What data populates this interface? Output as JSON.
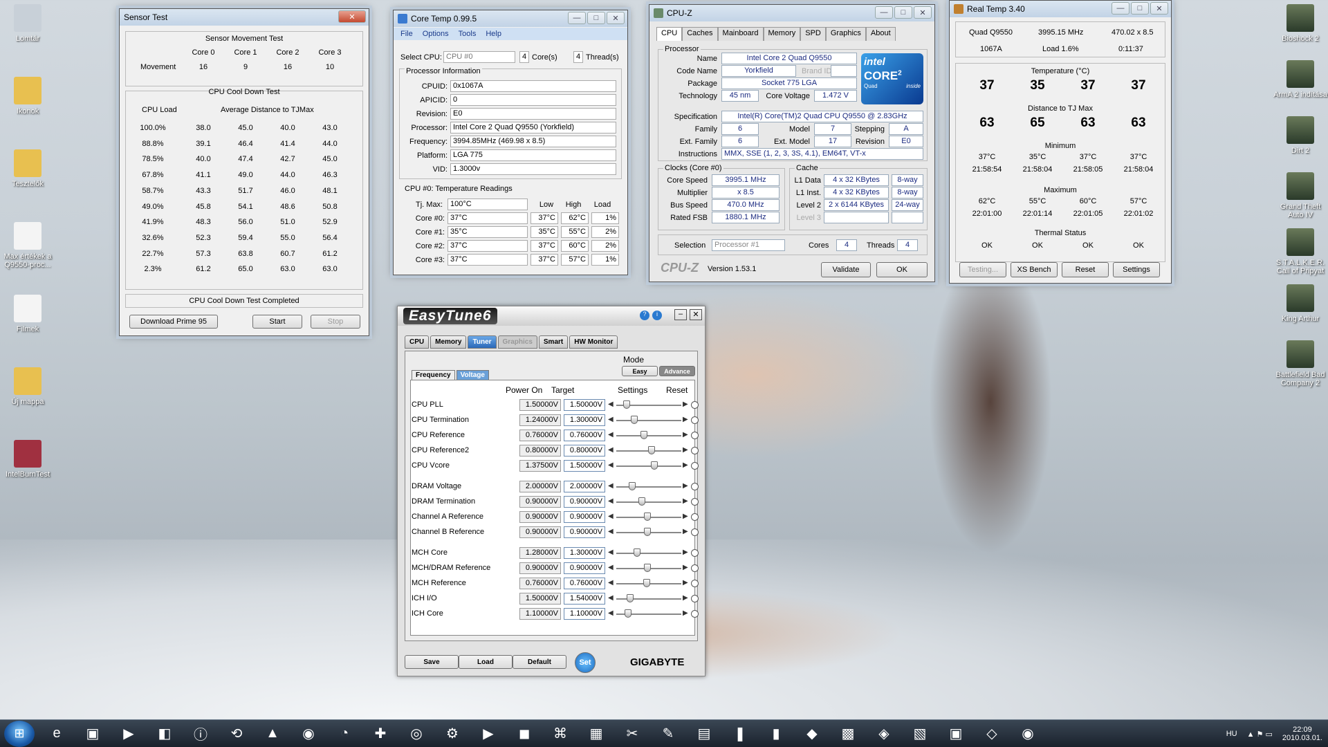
{
  "desktop": {
    "icons_left": [
      "Lomtár",
      "Ikonok",
      "Tesztelők",
      "Max értékek a Q9550-proc...",
      "Filmek",
      "Új mappa",
      "IntelBurnTest"
    ],
    "icons_right": [
      "Bioshock 2",
      "ArmA 2 indítása",
      "Dirt 2",
      "Grand Theft Auto IV",
      "S.T.A.L.K.E.R. Call of Pripyat",
      "King Arthur",
      "Battlefield Bad Company 2"
    ]
  },
  "sensor": {
    "title": "Sensor Test",
    "movement_title": "Sensor Movement Test",
    "cols": [
      "Core 0",
      "Core 1",
      "Core 2",
      "Core 3"
    ],
    "movement_label": "Movement",
    "movement": [
      "16",
      "9",
      "16",
      "10"
    ],
    "cooldown_title": "CPU Cool Down Test",
    "load_header": "CPU Load",
    "avg_header": "Average Distance to TJMax",
    "rows": [
      [
        "100.0%",
        "38.0",
        "45.0",
        "40.0",
        "43.0"
      ],
      [
        "88.8%",
        "39.1",
        "46.4",
        "41.4",
        "44.0"
      ],
      [
        "78.5%",
        "40.0",
        "47.4",
        "42.7",
        "45.0"
      ],
      [
        "67.8%",
        "41.1",
        "49.0",
        "44.0",
        "46.3"
      ],
      [
        "58.7%",
        "43.3",
        "51.7",
        "46.0",
        "48.1"
      ],
      [
        "49.0%",
        "45.8",
        "54.1",
        "48.6",
        "50.8"
      ],
      [
        "41.9%",
        "48.3",
        "56.0",
        "51.0",
        "52.9"
      ],
      [
        "32.6%",
        "52.3",
        "59.4",
        "55.0",
        "56.4"
      ],
      [
        "22.7%",
        "57.3",
        "63.8",
        "60.7",
        "61.2"
      ],
      [
        "2.3%",
        "61.2",
        "65.0",
        "63.0",
        "63.0"
      ]
    ],
    "status": "CPU Cool Down Test Completed",
    "btn_download": "Download Prime 95",
    "btn_start": "Start",
    "btn_stop": "Stop"
  },
  "coretemp": {
    "title": "Core Temp 0.99.5",
    "menu": [
      "File",
      "Options",
      "Tools",
      "Help"
    ],
    "select_label": "Select CPU:",
    "select_value": "CPU #0",
    "cores": "4",
    "cores_label": "Core(s)",
    "threads": "4",
    "threads_label": "Thread(s)",
    "info_title": "Processor Information",
    "info": [
      [
        "CPUID:",
        "0x1067A"
      ],
      [
        "APICID:",
        "0"
      ],
      [
        "Revision:",
        "E0"
      ],
      [
        "Processor:",
        "Intel Core 2 Quad Q9550 (Yorkfield)"
      ],
      [
        "Frequency:",
        "3994.85MHz (469.98 x 8.5)"
      ],
      [
        "Platform:",
        "LGA 775"
      ],
      [
        "VID:",
        "1.3000v"
      ]
    ],
    "temp_title": "CPU #0: Temperature Readings",
    "tj_label": "Tj. Max:",
    "tj_value": "100°C",
    "hdr_low": "Low",
    "hdr_high": "High",
    "hdr_load": "Load",
    "cores_rows": [
      [
        "Core #0:",
        "37°C",
        "37°C",
        "62°C",
        "1%"
      ],
      [
        "Core #1:",
        "35°C",
        "35°C",
        "55°C",
        "2%"
      ],
      [
        "Core #2:",
        "37°C",
        "37°C",
        "60°C",
        "2%"
      ],
      [
        "Core #3:",
        "37°C",
        "37°C",
        "57°C",
        "1%"
      ]
    ]
  },
  "cpuz": {
    "title": "CPU-Z",
    "tabs": [
      "CPU",
      "Caches",
      "Mainboard",
      "Memory",
      "SPD",
      "Graphics",
      "About"
    ],
    "processor_title": "Processor",
    "name_l": "Name",
    "name": "Intel Core 2 Quad Q9550",
    "code_l": "Code Name",
    "code": "Yorkfield",
    "brand_l": "Brand ID",
    "package_l": "Package",
    "package": "Socket 775 LGA",
    "tech_l": "Technology",
    "tech": "45 nm",
    "cv_l": "Core Voltage",
    "cv": "1.472 V",
    "spec_l": "Specification",
    "spec": "Intel(R) Core(TM)2 Quad CPU    Q9550  @ 2.83GHz",
    "family_l": "Family",
    "family": "6",
    "model_l": "Model",
    "model": "7",
    "stepping_l": "Stepping",
    "stepping": "A",
    "extfam_l": "Ext. Family",
    "extfam": "6",
    "extmod_l": "Ext. Model",
    "extmod": "17",
    "rev_l": "Revision",
    "rev": "E0",
    "instr_l": "Instructions",
    "instr": "MMX, SSE (1, 2, 3, 3S, 4.1), EM64T, VT-x",
    "logo_intel": "intel",
    "logo_core": "CORE",
    "logo_2": "2",
    "logo_quad": "Quad",
    "logo_inside": "inside",
    "clocks_title": "Clocks (Core #0)",
    "speed_l": "Core Speed",
    "speed": "3995.1 MHz",
    "mult_l": "Multiplier",
    "mult": "x 8.5",
    "bus_l": "Bus Speed",
    "bus": "470.0 MHz",
    "fsb_l": "Rated FSB",
    "fsb": "1880.1 MHz",
    "cache_title": "Cache",
    "l1d_l": "L1 Data",
    "l1d": "4 x 32 KBytes",
    "l1d_w": "8-way",
    "l1i_l": "L1 Inst.",
    "l1i": "4 x 32 KBytes",
    "l1i_w": "8-way",
    "l2_l": "Level 2",
    "l2": "2 x 6144 KBytes",
    "l2_w": "24-way",
    "l3_l": "Level 3",
    "sel_l": "Selection",
    "sel": "Processor #1",
    "cores_l": "Cores",
    "cores": "4",
    "threads_l": "Threads",
    "threads": "4",
    "brand": "CPU-Z",
    "version": "Version 1.53.1",
    "validate": "Validate",
    "ok": "OK"
  },
  "realtemp": {
    "title": "Real Temp 3.40",
    "cpu": "Quad Q9550",
    "mhz": "3995.15 MHz",
    "ratio": "470.02 x 8.5",
    "vid": "1067A",
    "load": "Load  1.6%",
    "time": "0:11:37",
    "temp_title": "Temperature (°C)",
    "temps": [
      "37",
      "35",
      "37",
      "37"
    ],
    "dist_title": "Distance to TJ Max",
    "dists": [
      "63",
      "65",
      "63",
      "63"
    ],
    "min_title": "Minimum",
    "mins": [
      "37°C",
      "35°C",
      "37°C",
      "37°C"
    ],
    "min_times": [
      "21:58:54",
      "21:58:04",
      "21:58:05",
      "21:58:04"
    ],
    "max_title": "Maximum",
    "maxs": [
      "62°C",
      "55°C",
      "60°C",
      "57°C"
    ],
    "max_times": [
      "22:01:00",
      "22:01:14",
      "22:01:05",
      "22:01:02"
    ],
    "thermal_title": "Thermal Status",
    "status": [
      "OK",
      "OK",
      "OK",
      "OK"
    ],
    "btns": [
      "Testing...",
      "XS Bench",
      "Reset",
      "Settings"
    ]
  },
  "easytune": {
    "title": "EasyTune6",
    "tabs": [
      "CPU",
      "Memory",
      "Tuner",
      "Graphics",
      "Smart",
      "HW Monitor"
    ],
    "subtabs": [
      "Frequency",
      "Voltage"
    ],
    "mode": "Mode",
    "mode_easy": "Easy",
    "mode_adv": "Advance",
    "h_power": "Power On",
    "h_target": "Target",
    "h_settings": "Settings",
    "h_reset": "Reset",
    "rows": [
      [
        "CPU PLL",
        "1.50000V",
        "1.50000V"
      ],
      [
        "CPU Termination",
        "1.24000V",
        "1.30000V"
      ],
      [
        "CPU Reference",
        "0.76000V",
        "0.76000V"
      ],
      [
        "CPU Reference2",
        "0.80000V",
        "0.80000V"
      ],
      [
        "CPU Vcore",
        "1.37500V",
        "1.50000V"
      ],
      [
        "DRAM Voltage",
        "2.00000V",
        "2.00000V"
      ],
      [
        "DRAM Termination",
        "0.90000V",
        "0.90000V"
      ],
      [
        "Channel A Reference",
        "0.90000V",
        "0.90000V"
      ],
      [
        "Channel B Reference",
        "0.90000V",
        "0.90000V"
      ],
      [
        "MCH Core",
        "1.28000V",
        "1.30000V"
      ],
      [
        "MCH/DRAM Reference",
        "0.90000V",
        "0.90000V"
      ],
      [
        "MCH Reference",
        "0.76000V",
        "0.76000V"
      ],
      [
        "ICH I/O",
        "1.50000V",
        "1.54000V"
      ],
      [
        "ICH Core",
        "1.10000V",
        "1.10000V"
      ]
    ],
    "slider_pos": [
      0.12,
      0.25,
      0.42,
      0.55,
      0.6,
      0.22,
      0.38,
      0.48,
      0.48,
      0.3,
      0.48,
      0.46,
      0.18,
      0.14
    ],
    "save": "Save",
    "load": "Load",
    "default": "Default",
    "set": "Set",
    "brand": "GIGABYTE"
  },
  "taskbar": {
    "lang": "HU",
    "time": "22:09",
    "date": "2010.03.01."
  }
}
